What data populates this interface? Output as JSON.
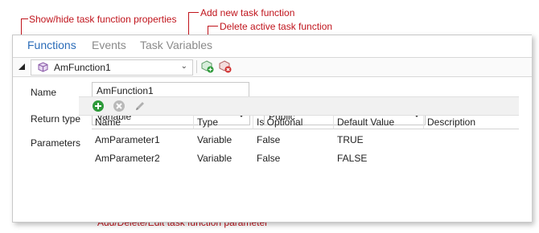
{
  "callouts": {
    "show_hide": "Show/hide task function properties",
    "add_new": "Add new task function",
    "delete_active": "Delete active task function",
    "param_edit": "Add/Delete/Edit task function parameter"
  },
  "tabs": [
    {
      "label": "Functions",
      "active": true
    },
    {
      "label": "Events",
      "active": false
    },
    {
      "label": "Task Variables",
      "active": false
    }
  ],
  "function_selector": {
    "value": "AmFunction1"
  },
  "form": {
    "name_label": "Name",
    "name_value": "AmFunction1",
    "return_type_label": "Return type",
    "return_type_value": "Variable",
    "visibility_value": "Public",
    "parameters_label": "Parameters"
  },
  "parameters": {
    "columns": [
      "Name",
      "Type",
      "Is Optional",
      "Default Value",
      "Description"
    ],
    "rows": [
      [
        "AmParameter1",
        "Variable",
        "False",
        "TRUE",
        ""
      ],
      [
        "AmParameter2",
        "Variable",
        "False",
        "FALSE",
        ""
      ]
    ]
  },
  "colors": {
    "accent": "#2b6cb8",
    "callout": "#c0141c",
    "add_green": "#2e9a3a"
  },
  "icons": [
    "collapse-triangle-icon",
    "function-cube-icon",
    "add-function-icon",
    "delete-function-icon",
    "add-parameter-icon",
    "delete-parameter-icon",
    "edit-parameter-icon"
  ]
}
